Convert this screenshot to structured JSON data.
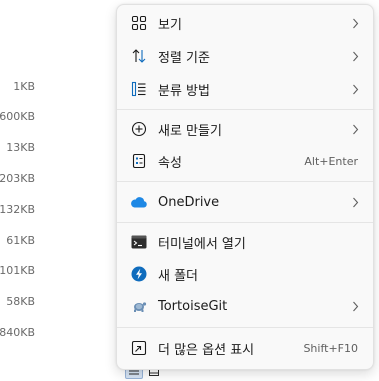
{
  "background": {
    "size_column": [
      "1KB",
      "600KB",
      "13KB",
      "203KB",
      "132KB",
      "61KB",
      "101KB",
      "58KB",
      "840KB"
    ]
  },
  "menu": {
    "items": [
      {
        "label": "보기",
        "icon": "grid-icon",
        "has_submenu": true
      },
      {
        "label": "정렬 기준",
        "icon": "sort-icon",
        "has_submenu": true
      },
      {
        "label": "분류 방법",
        "icon": "group-list-icon",
        "has_submenu": true
      },
      {
        "label": "새로 만들기",
        "icon": "add-circle-icon",
        "has_submenu": true
      },
      {
        "label": "속성",
        "icon": "properties-icon",
        "shortcut": "Alt+Enter"
      },
      {
        "label": "OneDrive",
        "icon": "onedrive-cloud-icon",
        "has_submenu": true
      },
      {
        "label": "터미널에서 열기",
        "icon": "terminal-icon"
      },
      {
        "label": "새 폴더",
        "icon": "new-folder-icon"
      },
      {
        "label": "TortoiseGit",
        "icon": "tortoisegit-icon",
        "has_submenu": true
      },
      {
        "label": "더 많은 옵션 표시",
        "icon": "more-options-icon",
        "shortcut": "Shift+F10"
      }
    ]
  },
  "colors": {
    "menu_bg": "#f9f9f9",
    "text": "#1b1b1b",
    "muted": "#5f5f5f",
    "accent_blue": "#0f6cbd",
    "onedrive_blue": "#1e88e5"
  }
}
